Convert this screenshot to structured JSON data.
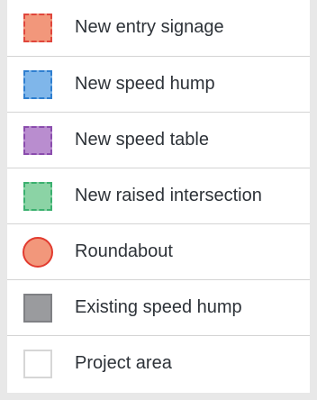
{
  "legend": {
    "items": [
      {
        "label": "New entry signage",
        "icon": "dashed-square-icon",
        "fill": "#f2977b",
        "border": "#e0463c"
      },
      {
        "label": "New speed hump",
        "icon": "dashed-square-icon",
        "fill": "#7fb6ea",
        "border": "#2f7fd0"
      },
      {
        "label": "New speed table",
        "icon": "dashed-square-icon",
        "fill": "#b98dcf",
        "border": "#8a4cad"
      },
      {
        "label": "New raised intersection",
        "icon": "dashed-square-icon",
        "fill": "#8bd3a5",
        "border": "#3bb06f"
      },
      {
        "label": "Roundabout",
        "icon": "circle-icon",
        "fill": "#f2977b",
        "border": "#e23b2f"
      },
      {
        "label": "Existing speed hump",
        "icon": "solid-square-icon",
        "fill": "#9a9b9e",
        "border": "#7f8084"
      },
      {
        "label": "Project area",
        "icon": "outline-square-icon",
        "fill": "#ffffff",
        "border": "#d6d6d6"
      }
    ]
  }
}
